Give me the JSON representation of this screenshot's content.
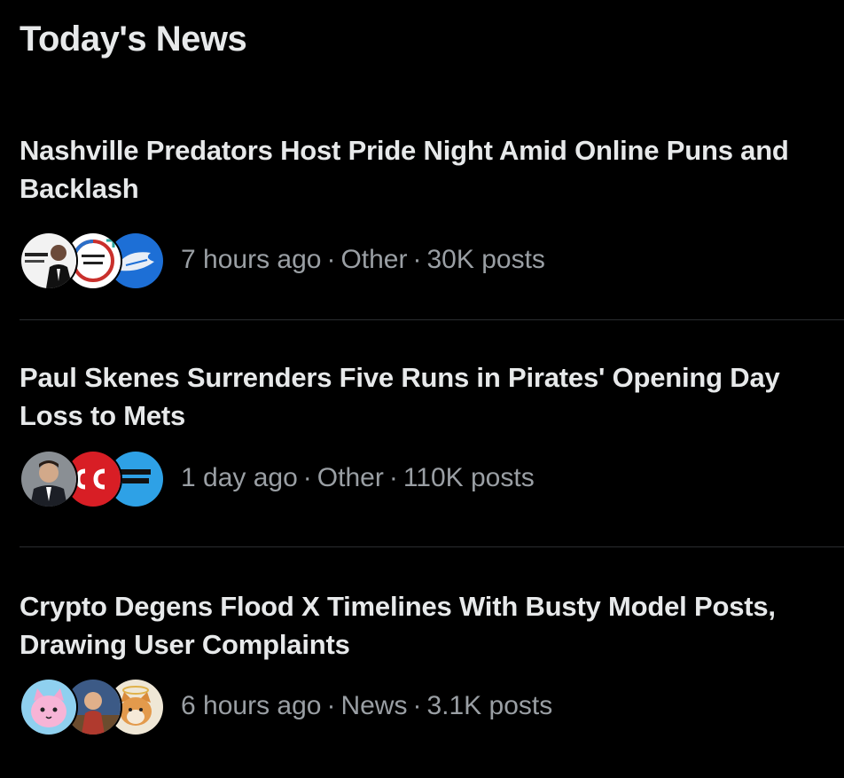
{
  "section": {
    "title": "Today's News"
  },
  "items": [
    {
      "headline": "Nashville Predators Host Pride Night Amid Online Puns and Backlash",
      "time": "7 hours ago",
      "category": "Other",
      "posts": "30K posts",
      "avatars": [
        "news-logo-avatar",
        "pride-text-avatar",
        "predators-logo-avatar"
      ]
    },
    {
      "headline": "Paul Skenes Surrenders Five Runs in Pirates' Opening Day Loss to Mets",
      "time": "1 day ago",
      "category": "Other",
      "posts": "110K posts",
      "avatars": [
        "reporter-avatar",
        "sc-logo-avatar",
        "text-logo-avatar"
      ]
    },
    {
      "headline": "Crypto Degens Flood X Timelines With Busty Model Posts, Drawing User Complaints",
      "time": "6 hours ago",
      "category": "News",
      "posts": "3.1K posts",
      "avatars": [
        "pink-cat-avatar",
        "illustrated-character-avatar",
        "shiba-dog-avatar"
      ]
    }
  ],
  "separator": "·",
  "colors": {
    "background": "#000000",
    "headline": "#e7e9ea",
    "meta": "#9a9fa4",
    "divider": "#2a2d30"
  }
}
